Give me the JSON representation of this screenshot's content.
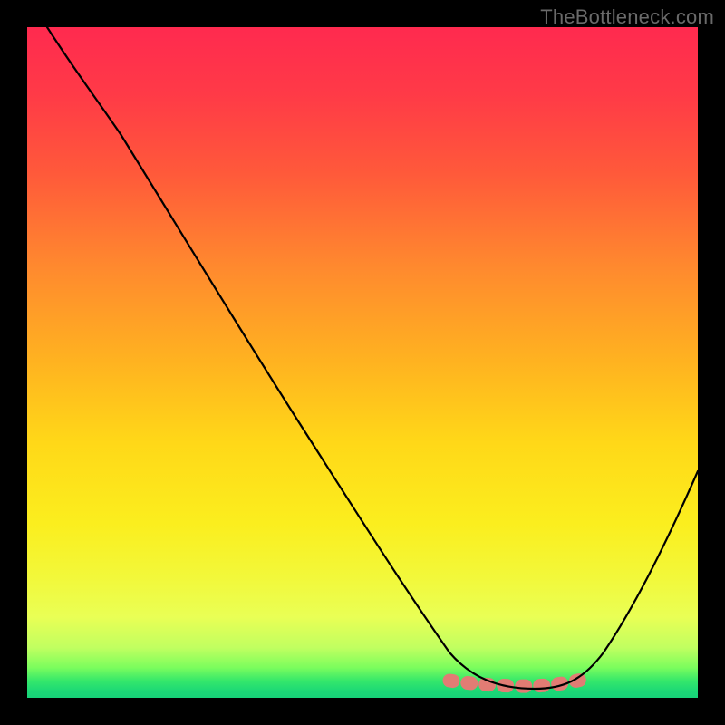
{
  "watermark": "TheBottleneck.com",
  "colors": {
    "background": "#000000",
    "gradient_top": "#ff2a4f",
    "gradient_mid_orange": "#ff8a2e",
    "gradient_mid_yellow": "#ffd818",
    "gradient_bottom_green": "#17d278",
    "curve": "#000000",
    "trough_dots": "#e27c74"
  },
  "chart_data": {
    "type": "line",
    "title": "",
    "xlabel": "",
    "ylabel": "",
    "x_range": [
      0,
      100
    ],
    "y_range": [
      0,
      100
    ],
    "note": "Axes have no visible tick labels; values are approximate readings of the plotted curve inside the gradient square, (0,0) at bottom-left.",
    "series": [
      {
        "name": "curve",
        "points": [
          {
            "x": 3,
            "y": 100
          },
          {
            "x": 8,
            "y": 94
          },
          {
            "x": 14,
            "y": 88
          },
          {
            "x": 20,
            "y": 79
          },
          {
            "x": 28,
            "y": 66
          },
          {
            "x": 36,
            "y": 52
          },
          {
            "x": 44,
            "y": 38
          },
          {
            "x": 52,
            "y": 25
          },
          {
            "x": 58,
            "y": 15
          },
          {
            "x": 63,
            "y": 8
          },
          {
            "x": 68,
            "y": 4
          },
          {
            "x": 72,
            "y": 2.5
          },
          {
            "x": 76,
            "y": 2
          },
          {
            "x": 80,
            "y": 2.5
          },
          {
            "x": 84,
            "y": 5
          },
          {
            "x": 88,
            "y": 12
          },
          {
            "x": 93,
            "y": 22
          },
          {
            "x": 100,
            "y": 34
          }
        ]
      }
    ],
    "trough_marker": {
      "x_start": 63,
      "x_end": 85,
      "y": 2.5,
      "style": "dotted"
    }
  }
}
